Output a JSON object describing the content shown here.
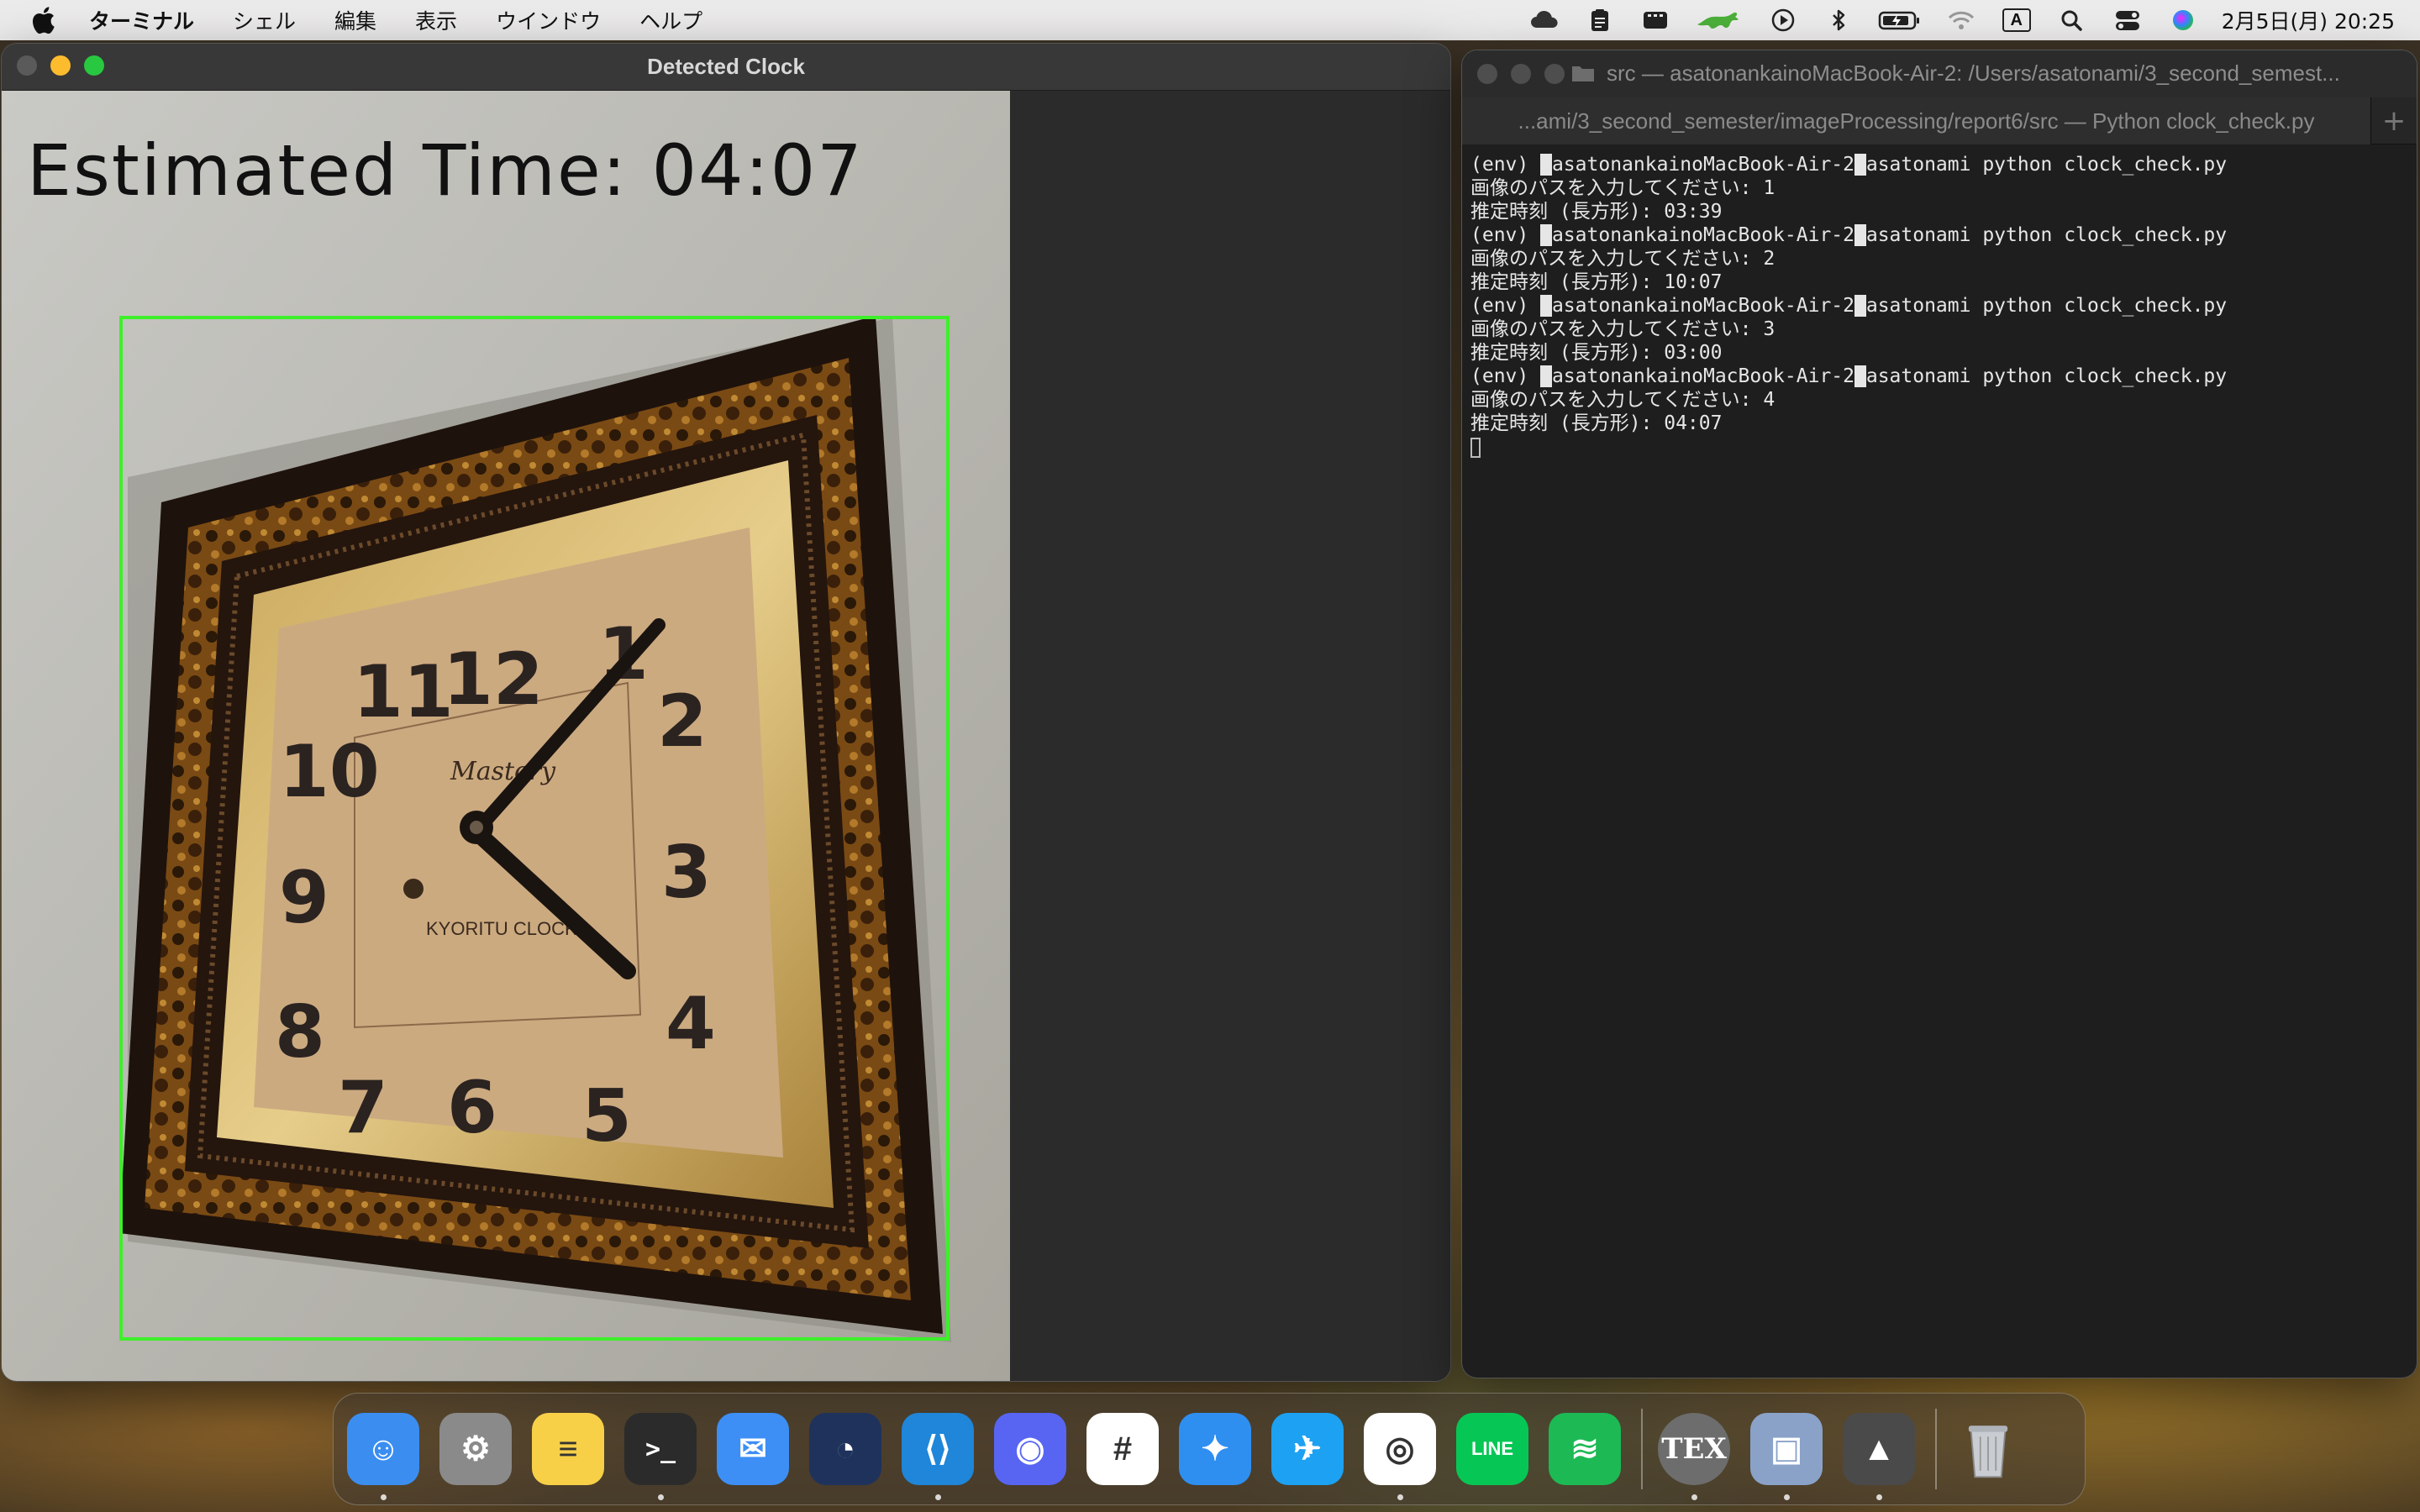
{
  "menubar": {
    "apple_icon": "apple-logo-icon",
    "app_name": "ターミナル",
    "items": [
      "シェル",
      "編集",
      "表示",
      "ウインドウ",
      "ヘルプ"
    ],
    "status_icons": [
      "creative-cloud-icon",
      "clipboard-icon",
      "film-icon",
      "runcat-icon",
      "play-circle-icon",
      "bluetooth-icon",
      "battery-icon",
      "wifi-icon",
      "input-source-icon",
      "search-icon",
      "control-center-icon",
      "siri-icon"
    ],
    "input_source_label": "A",
    "datetime": "2月5日(月)  20:25"
  },
  "left_window": {
    "title": "Detected Clock",
    "overlay_text": "Estimated Time: 04:07",
    "box_color": "#3df02a",
    "clock_face": {
      "brand": "Mastery",
      "maker": "KYORITU CLOCK",
      "numerals": [
        "12",
        "1",
        "2",
        "3",
        "4",
        "5",
        "6",
        "7",
        "8",
        "9",
        "10",
        "11"
      ]
    }
  },
  "terminal": {
    "title": "src — asatonankainoMacBook-Air-2: /Users/asatonami/3_second_semest...",
    "tab_label": "...ami/3_second_semester/imageProcessing/report6/src — Python clock_check.py",
    "new_tab_label": "+",
    "lines": [
      {
        "type": "prompt",
        "prefix": "(env) ",
        "host": "asatonankainoMacBook-Air-2",
        "user": "asatonami",
        "cmd": " python clock_check.py"
      },
      {
        "type": "out",
        "text": "画像のパスを入力してください: 1"
      },
      {
        "type": "out",
        "text": "推定時刻 (長方形): 03:39"
      },
      {
        "type": "prompt",
        "prefix": "(env) ",
        "host": "asatonankainoMacBook-Air-2",
        "user": "asatonami",
        "cmd": " python clock_check.py"
      },
      {
        "type": "out",
        "text": "画像のパスを入力してください: 2"
      },
      {
        "type": "out",
        "text": "推定時刻 (長方形): 10:07"
      },
      {
        "type": "prompt",
        "prefix": "(env) ",
        "host": "asatonankainoMacBook-Air-2",
        "user": "asatonami",
        "cmd": " python clock_check.py"
      },
      {
        "type": "out",
        "text": "画像のパスを入力してください: 3"
      },
      {
        "type": "out",
        "text": "推定時刻 (長方形): 03:00"
      },
      {
        "type": "prompt",
        "prefix": "(env) ",
        "host": "asatonankainoMacBook-Air-2",
        "user": "asatonami",
        "cmd": " python clock_check.py"
      },
      {
        "type": "out",
        "text": "画像のパスを入力してください: 4"
      },
      {
        "type": "out",
        "text": "推定時刻 (長方形): 04:07"
      }
    ]
  },
  "dock": {
    "apps": [
      {
        "name": "Finder",
        "icon": "finder-icon",
        "color": "#3b8ef0",
        "running": true
      },
      {
        "name": "System Settings",
        "icon": "settings-icon",
        "color": "#8a8a8a",
        "running": false
      },
      {
        "name": "Notes",
        "icon": "notes-icon",
        "color": "#f7d048",
        "running": false
      },
      {
        "name": "Terminal",
        "icon": "terminal-icon",
        "color": "#2b2b2b",
        "running": true
      },
      {
        "name": "Mail",
        "icon": "mail-icon",
        "color": "#3d8ff5",
        "running": false
      },
      {
        "name": "Mattermost",
        "icon": "mattermost-icon",
        "color": "#1e325c",
        "running": false
      },
      {
        "name": "VS Code",
        "icon": "vscode-icon",
        "color": "#1f86d9",
        "running": true
      },
      {
        "name": "Discord",
        "icon": "discord-icon",
        "color": "#5865f2",
        "running": false
      },
      {
        "name": "Slack",
        "icon": "slack-icon",
        "color": "#ffffff",
        "running": false
      },
      {
        "name": "Safari",
        "icon": "safari-icon",
        "color": "#2f8ff0",
        "running": false
      },
      {
        "name": "Twitter",
        "icon": "twitter-icon",
        "color": "#1da1f2",
        "running": false
      },
      {
        "name": "Chrome",
        "icon": "chrome-icon",
        "color": "#ffffff",
        "running": true
      },
      {
        "name": "LINE",
        "icon": "line-icon",
        "color": "#06c755",
        "running": false
      },
      {
        "name": "Spotify",
        "icon": "spotify-icon",
        "color": "#1db954",
        "running": false
      }
    ],
    "apps_after_sep": [
      {
        "name": "TeX",
        "icon": "tex-icon",
        "label": "TEX",
        "color": "#6d6d6d",
        "running": true
      },
      {
        "name": "Preview",
        "icon": "preview-icon",
        "color": "#8aa2c8",
        "running": true
      },
      {
        "name": "Python Launcher",
        "icon": "python-rocket-icon",
        "color": "#4a4a4a",
        "running": true
      }
    ],
    "trash": {
      "name": "Trash",
      "icon": "trash-icon"
    }
  }
}
